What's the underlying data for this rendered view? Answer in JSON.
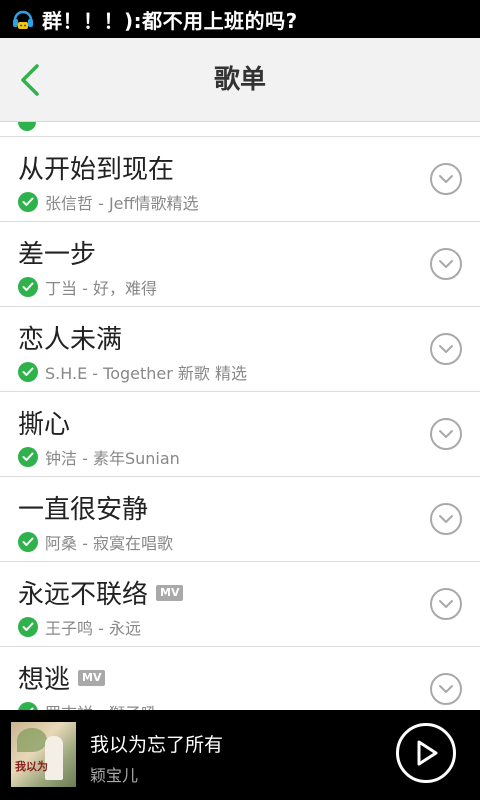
{
  "status_bar": {
    "notification_icon": "qq-chat-icon",
    "notification_text": "群！！！):都不用上班的吗?"
  },
  "header": {
    "back_icon": "chevron-left-icon",
    "title": "歌单"
  },
  "songs": [
    {
      "title": "从开始到现在",
      "subtitle": "张信哲 - Jeff情歌精选",
      "mv": ""
    },
    {
      "title": "差一步",
      "subtitle": "丁当 - 好，难得",
      "mv": ""
    },
    {
      "title": "恋人未满",
      "subtitle": "S.H.E - Together 新歌 精选",
      "mv": ""
    },
    {
      "title": "撕心",
      "subtitle": "钟洁 - 素年Sunian",
      "mv": ""
    },
    {
      "title": "一直很安静",
      "subtitle": "阿桑 - 寂寞在唱歌",
      "mv": ""
    },
    {
      "title": "永远不联络",
      "subtitle": "王子鸣 - 永远",
      "mv": "MV"
    },
    {
      "title": "想逃",
      "subtitle": "罗志祥 - 獅子吼",
      "mv": "MV"
    }
  ],
  "player": {
    "track": "我以为忘了所有",
    "artist": "颖宝儿",
    "cover_text": "我以为",
    "play_icon": "play-icon"
  },
  "colors": {
    "accent": "#2fb24c",
    "header_bg": "#f2f2f2",
    "player_bg": "#000000"
  }
}
